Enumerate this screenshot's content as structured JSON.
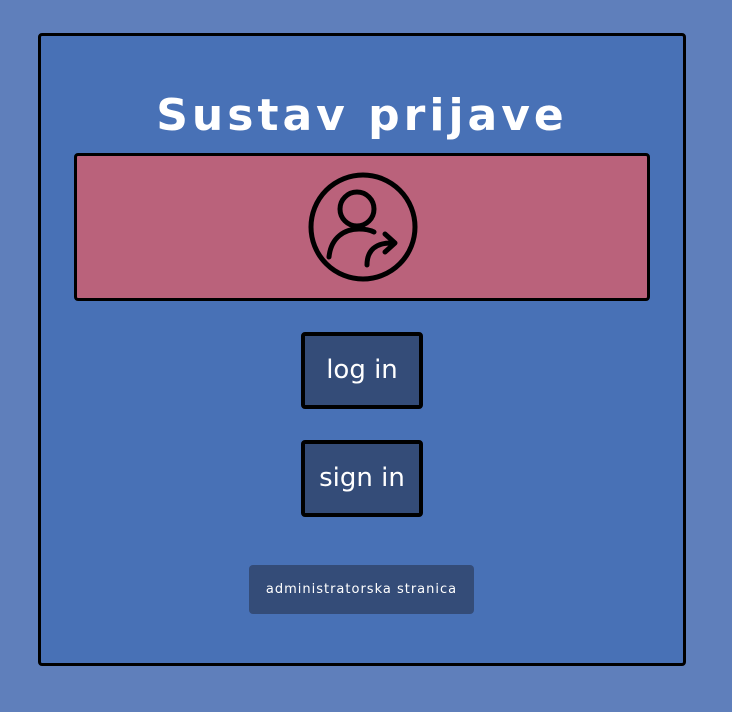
{
  "page": {
    "title": "Sustav prijave"
  },
  "banner": {
    "icon": "user-login-icon"
  },
  "buttons": {
    "login_label": "log in",
    "signin_label": "sign in",
    "admin_label": "administratorska stranica"
  },
  "colors": {
    "background": "#5f7fbb",
    "panel": "#4871b6",
    "banner": "#ba627b",
    "button": "#344c78",
    "text": "#ffffff",
    "border": "#000000"
  }
}
